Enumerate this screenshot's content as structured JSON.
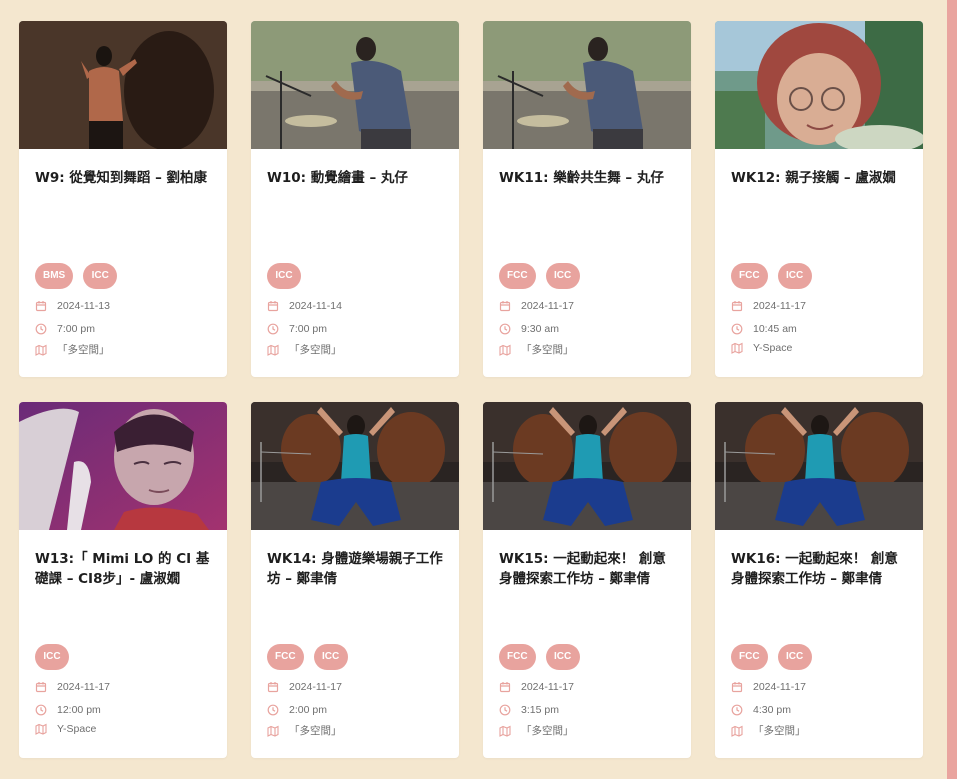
{
  "events": [
    {
      "title": "W9: 從覺知到舞蹈 – 劉柏康",
      "tags": [
        "BMS",
        "ICC"
      ],
      "date": "2024-11-13",
      "time": "7:00 pm",
      "venue": "「多空間」"
    },
    {
      "title": "W10: 動覺繪畫 – 丸仔",
      "tags": [
        "ICC"
      ],
      "date": "2024-11-14",
      "time": "7:00 pm",
      "venue": "「多空間」"
    },
    {
      "title": "WK11: 樂齡共生舞 – 丸仔",
      "tags": [
        "FCC",
        "ICC"
      ],
      "date": "2024-11-17",
      "time": "9:30 am",
      "venue": "「多空間」"
    },
    {
      "title": "WK12: 親子接觸 – 盧淑嫺",
      "tags": [
        "FCC",
        "ICC"
      ],
      "date": "2024-11-17",
      "time": "10:45 am",
      "venue": "Y-Space"
    },
    {
      "title": "W13:「 Mimi LO 的 CI 基礎課 – CI8步」- 盧淑嫺",
      "tags": [
        "ICC"
      ],
      "date": "2024-11-17",
      "time": "12:00 pm",
      "venue": "Y-Space"
    },
    {
      "title": "WK14: 身體遊樂場親子工作坊 – 鄭聿倩",
      "tags": [
        "FCC",
        "ICC"
      ],
      "date": "2024-11-17",
      "time": "2:00 pm",
      "venue": "「多空間」"
    },
    {
      "title": "WK15: 一起動起來！ 創意身體探索工作坊 – 鄭聿倩",
      "tags": [
        "FCC",
        "ICC"
      ],
      "date": "2024-11-17",
      "time": "3:15 pm",
      "venue": "「多空間」"
    },
    {
      "title": "WK16: 一起動起來！ 創意身體探索工作坊 – 鄭聿倩",
      "tags": [
        "FCC",
        "ICC"
      ],
      "date": "2024-11-17",
      "time": "4:30 pm",
      "venue": "「多空間」"
    }
  ],
  "icons": {
    "date": "calendar-icon",
    "time": "clock-icon",
    "venue": "map-icon"
  },
  "colors": {
    "background": "#f4e7cf",
    "card": "#ffffff",
    "tag": "#e8a39e",
    "icon": "#e8a39e",
    "title": "#1e1e1e",
    "meta": "#6f6f6f",
    "side_bar": "#e9a49f"
  }
}
